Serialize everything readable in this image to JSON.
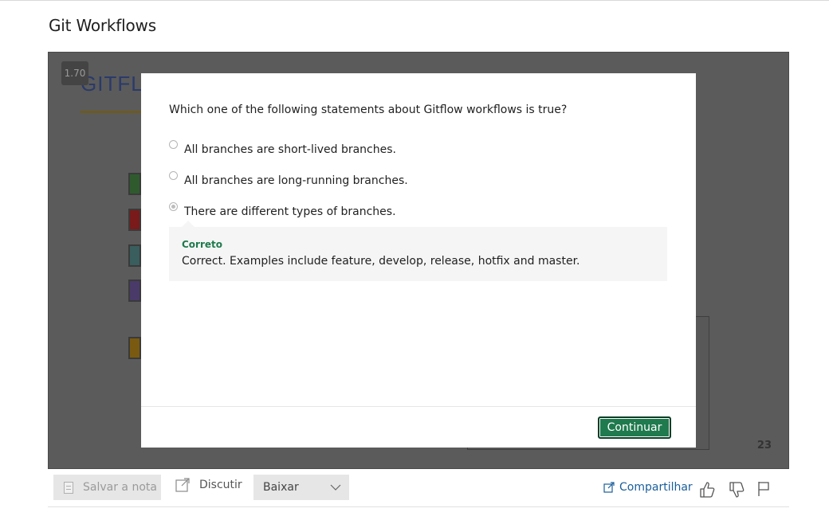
{
  "page": {
    "title": "Git Workflows"
  },
  "player": {
    "speed": "1.70",
    "slide_title": "GITFL",
    "slide_number": "23"
  },
  "quiz": {
    "question": "Which one of the following statements about Gitflow workflows is true?",
    "options": [
      {
        "label": "All branches are short-lived branches.",
        "selected": false
      },
      {
        "label": "All branches are long-running branches.",
        "selected": false
      },
      {
        "label": "There are different types of branches.",
        "selected": true
      }
    ],
    "feedback": {
      "title": "Correto",
      "text": "Correct. Examples include feature, develop, release, hotfix and master."
    },
    "continue_label": "Continuar"
  },
  "toolbar": {
    "save_note_label": "Salvar a nota",
    "discuss_label": "Discutir",
    "download_label": "Baixar",
    "share_label": "Compartilhar"
  },
  "colors": {
    "accent": "#1f7a4d",
    "link": "#1b5e9a",
    "feedback_bg": "#f5f5f5"
  },
  "icons": [
    "note-icon",
    "external-link-icon",
    "chevron-down-icon",
    "share-icon",
    "thumbs-up-icon",
    "thumbs-down-icon",
    "flag-icon"
  ]
}
